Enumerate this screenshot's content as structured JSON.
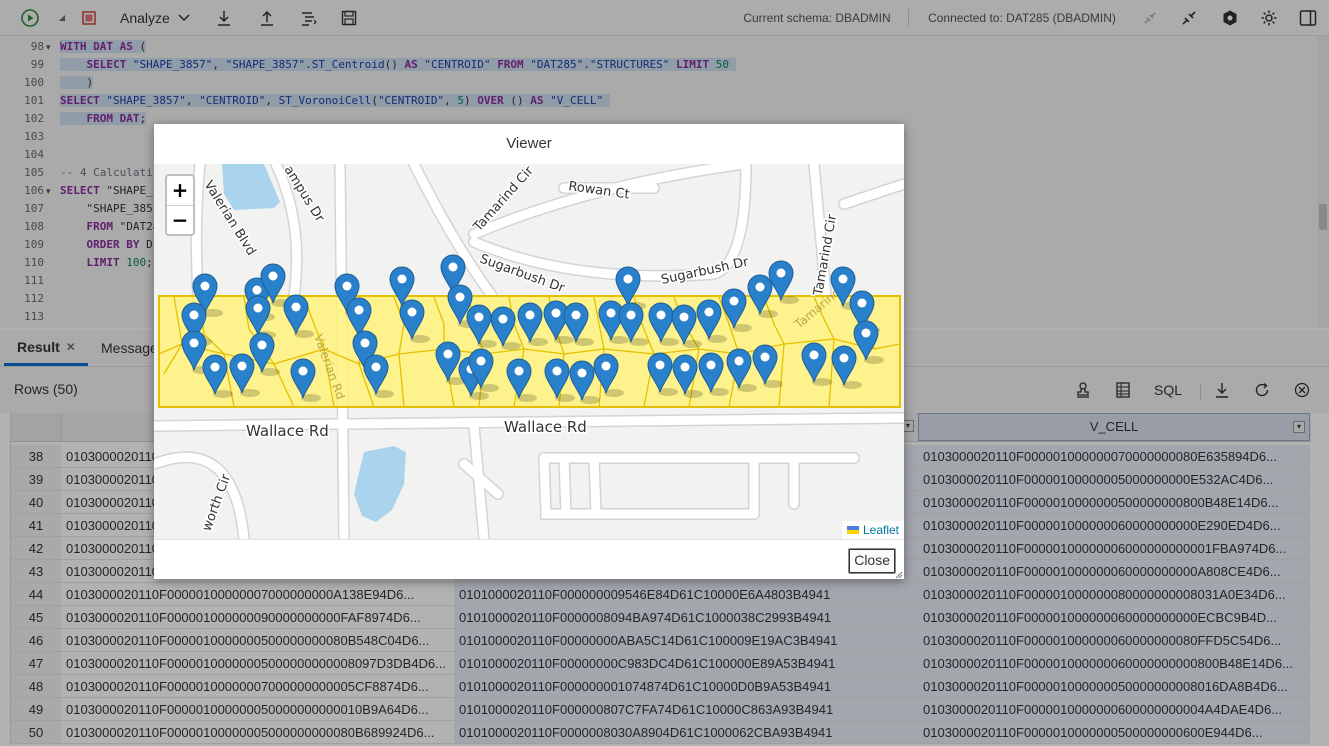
{
  "toolbar": {
    "analyze_label": "Analyze",
    "schema_text": "Current schema: DBADMIN",
    "connection_text": "Connected to: DAT285 (DBADMIN)"
  },
  "editor": {
    "lines": [
      {
        "num": "98",
        "fold": true,
        "html": "<span class='hl'><span class='kw'>WITH</span> <span class='kw'>DAT</span> <span class='kw'>AS</span> (</span>"
      },
      {
        "num": "99",
        "html": "<span class='hl'>    <span class='kw'>SELECT</span> <span class='str'>\"SHAPE_3857\"</span>, <span class='str'>\"SHAPE_3857\"</span>.<span class='fn'>ST_Centroid</span>() <span class='kw'>AS</span> <span class='str'>\"CENTROID\"</span> <span class='kw'>FROM</span> <span class='str'>\"DAT285\"</span>.<span class='str'>\"STRUCTURES\"</span> <span class='kw'>LIMIT</span> <span class='num'>50</span> </span>"
      },
      {
        "num": "100",
        "html": "<span class='hl'>    )</span>"
      },
      {
        "num": "101",
        "html": "<span class='hl'><span class='kw'>SELECT</span> <span class='str'>\"SHAPE_3857\"</span>, <span class='str'>\"CENTROID\"</span>, <span class='fn'>ST_VoronoiCell</span>(<span class='str'>\"CENTROID\"</span>, <span class='num'>5</span>) <span class='kw'>OVER</span> () <span class='kw'>AS</span> <span class='str'>\"V_CELL\"</span> </span>"
      },
      {
        "num": "102",
        "html": "<span class='hl'>    <span class='kw'>FROM</span> <span class='kw'>DAT</span>;</span>"
      },
      {
        "num": "103",
        "html": ""
      },
      {
        "num": "104",
        "html": ""
      },
      {
        "num": "105",
        "html": "<span class='cm'>-- 4 Calculati</span>"
      },
      {
        "num": "106",
        "fold": true,
        "html": "<span class='kw'>SELECT</span> \"SHAPE_"
      },
      {
        "num": "107",
        "html": "    \"SHAPE_385"
      },
      {
        "num": "108",
        "html": "    <span class='kw'>FROM</span> \"DAT28"
      },
      {
        "num": "109",
        "html": "    <span class='kw'>ORDER BY</span> D"
      },
      {
        "num": "110",
        "html": "    <span class='kw'>LIMIT</span> <span class='num'>100</span>;"
      },
      {
        "num": "111",
        "html": ""
      },
      {
        "num": "112",
        "html": ""
      },
      {
        "num": "113",
        "html": ""
      }
    ]
  },
  "tabs": {
    "result": "Result",
    "messages": "Message"
  },
  "results": {
    "rows_label": "Rows (50)",
    "sql_label": "SQL",
    "vcell_header": "V_CELL",
    "rows": [
      {
        "n": "38",
        "a": "0103000020110",
        "b": "",
        "c": "0103000020110F000001000000070000000080E635894D6..."
      },
      {
        "n": "39",
        "a": "0103000020110",
        "b": "",
        "c": "0103000020110F00000100000005000000000E532AC4D6..."
      },
      {
        "n": "40",
        "a": "0103000020110",
        "b": "",
        "c": "0103000020110F0000010000000500000000800B48E14D6..."
      },
      {
        "n": "41",
        "a": "0103000020110",
        "b": "",
        "c": "0103000020110F000001000000060000000000E290ED4D6..."
      },
      {
        "n": "42",
        "a": "0103000020110",
        "b": "",
        "c": "0103000020110F00000100000006000000000001FBA974D6..."
      },
      {
        "n": "43",
        "a": "0103000020110",
        "b": "",
        "c": "0103000020110F000001000000060000000000A808CE4D6..."
      },
      {
        "n": "44",
        "a": "0103000020110F00000100000007000000000A138E94D6...",
        "b": "0101000020110F000000009546E84D61C10000E6A4803B4941",
        "c": "0103000020110F000001000000080000000008031A0E34D6..."
      },
      {
        "n": "45",
        "a": "0103000020110F000001000000090000000000FAF8974D6...",
        "b": "0101000020110F0000008094BA974D61C1000038C2993B4941",
        "c": "0103000020110F000001000000060000000000ECBC9B4D..."
      },
      {
        "n": "46",
        "a": "0103000020110F0000010000000500000000080B548C04D6...",
        "b": "0101000020110F00000000ABA5C14D61C100009E19AC3B4941",
        "c": "0103000020110F000001000000060000000080FFD5C54D6..."
      },
      {
        "n": "47",
        "a": "0103000020110F00000100000005000000000008097D3DB4D6...",
        "b": "0101000020110F00000000C983DC4D61C100000E89A53B4941",
        "c": "0103000020110F000001000000060000000000800B48E14D6..."
      },
      {
        "n": "48",
        "a": "0103000020110F00000100000007000000000005CF8874D6...",
        "b": "0101000020110F000000001074874D61C10000D0B9A53B4941",
        "c": "0103000020110F000001000000050000000008016DA8B4D6..."
      },
      {
        "n": "49",
        "a": "0103000020110F000001000000050000000000010B9A64D6...",
        "b": "0101000020110F000000807C7FA74D61C10000C863A93B4941",
        "c": "0103000020110F0000010000000600000000004A4DAE4D6..."
      },
      {
        "n": "50",
        "a": "0103000020110F00000100000005000000000080B689924D6...",
        "b": "0101000020110F0000008030A8904D61C1000062CBA93B4941",
        "c": "0103000020110F0000010000000500000000600E944D6..."
      }
    ]
  },
  "dialog": {
    "title": "Viewer",
    "zoom_in": "+",
    "zoom_out": "−",
    "attribution": "Leaflet",
    "close_label": "Close",
    "streets": {
      "valerian_blvd": "Valerian Blvd",
      "campus_dr": "ampus Dr",
      "tamarind_cir": "Tamarind Cir",
      "rowan_ct": "Rowan Ct",
      "sugarbush_dr_1": "Sugarbush Dr",
      "sugarbush_dr_2": "Sugarbush Dr",
      "tamarind_cir_2": "Tamarind Cir",
      "wallace_rd_1": "Wallace Rd",
      "wallace_rd_2": "Wallace Rd",
      "valerian_rd": "Valerian Rd",
      "worth_cir": "worth Cir",
      "tamarind_lower": "Tamarind Cir"
    }
  },
  "colors": {
    "accent": "#0a6ed1",
    "voronoi_fill": "#fff27a",
    "voronoi_stroke": "#e6c000",
    "marker": "#2a81cb",
    "water": "#aad3ee"
  }
}
